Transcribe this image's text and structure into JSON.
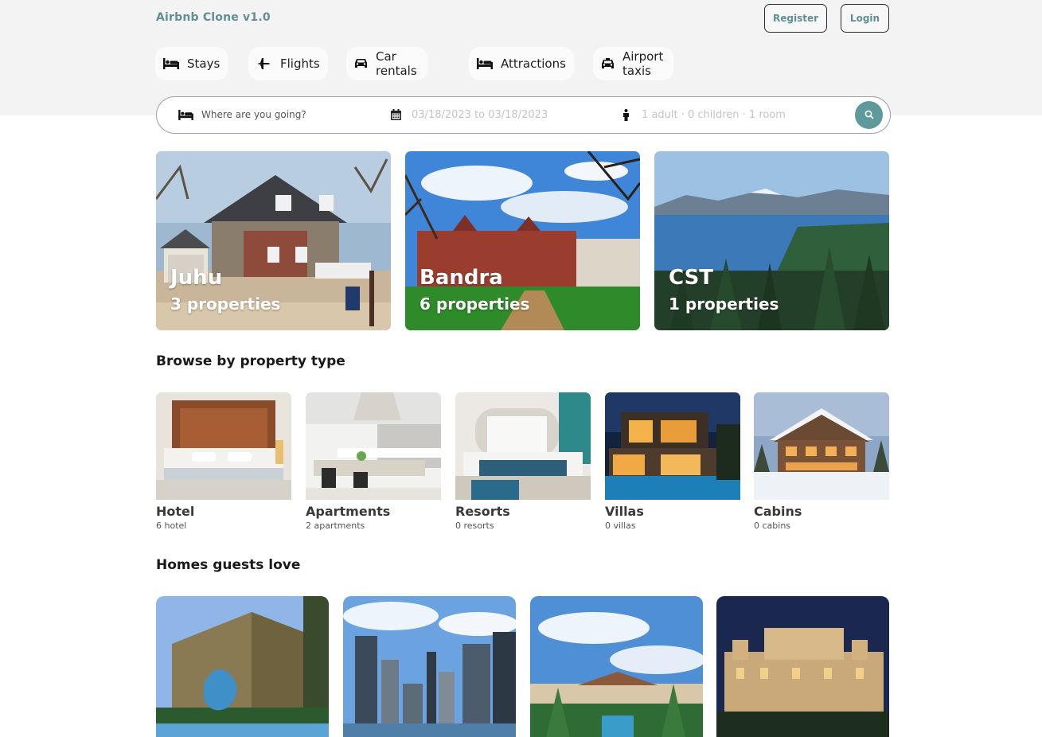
{
  "header": {
    "brand": "Airbnb Clone v1.0",
    "register_label": "Register",
    "login_label": "Login"
  },
  "nav": {
    "tabs": [
      {
        "label": "Stays",
        "icon": "bed-icon"
      },
      {
        "label": "Flights",
        "icon": "plane-icon"
      },
      {
        "label": "Car rentals",
        "icon": "car-icon"
      },
      {
        "label": "Attractions",
        "icon": "bed-icon"
      },
      {
        "label": "Airport taxis",
        "icon": "taxi-icon"
      }
    ]
  },
  "search": {
    "destination_placeholder": "Where are you going?",
    "dates": "03/18/2023 to 03/18/2023",
    "guests": "1 adult · 0 children · 1 room"
  },
  "featured": [
    {
      "name": "Juhu",
      "count": "3 properties"
    },
    {
      "name": "Bandra",
      "count": "6 properties"
    },
    {
      "name": "CST",
      "count": "1 properties"
    }
  ],
  "property_types": {
    "title": "Browse by property type",
    "items": [
      {
        "name": "Hotel",
        "count": "6 hotel"
      },
      {
        "name": "Apartments",
        "count": "2 apartments"
      },
      {
        "name": "Resorts",
        "count": "0 resorts"
      },
      {
        "name": "Villas",
        "count": "0 villas"
      },
      {
        "name": "Cabins",
        "count": "0 cabins"
      }
    ]
  },
  "homes": {
    "title": "Homes guests love"
  },
  "colors": {
    "accent": "#5f8f93",
    "search_button": "#5f9a9b",
    "top_band": "#f3f3f3"
  }
}
